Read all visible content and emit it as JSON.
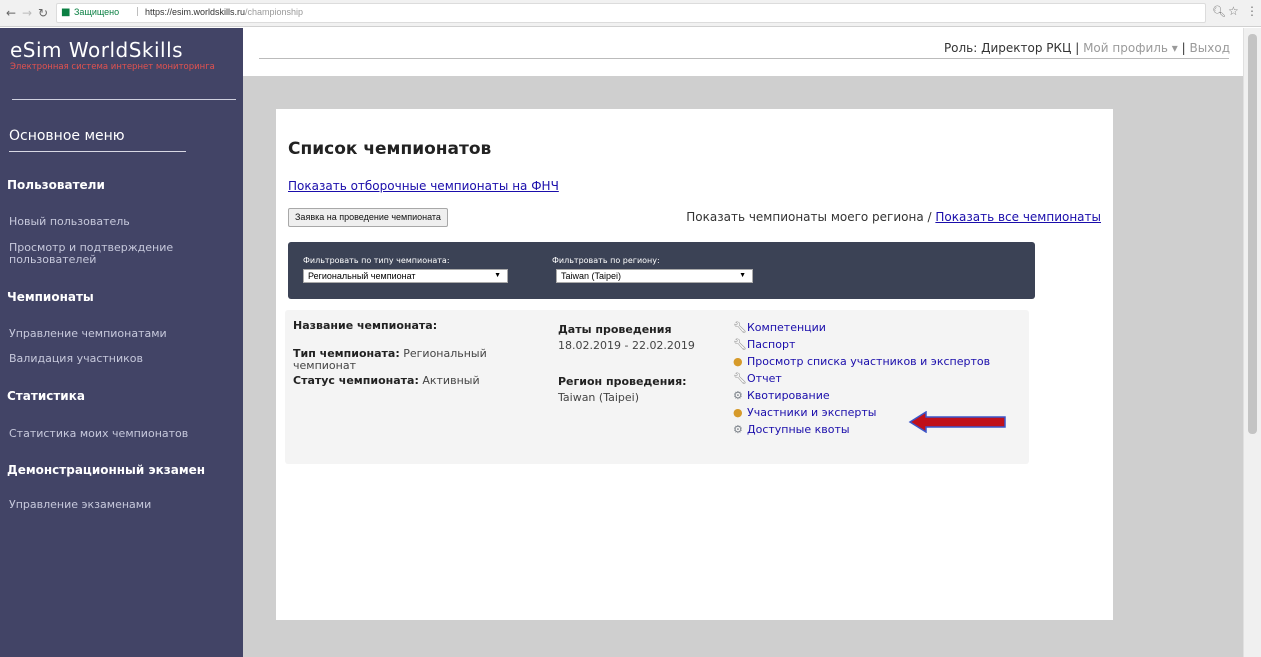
{
  "browser": {
    "secure_label": "Защищено",
    "url_host": "https://esim.worldskills.ru",
    "url_path": "/championship"
  },
  "sidebar": {
    "brand": "eSim WorldSkills",
    "brand_sub": "Электронная система интернет мониторинга",
    "menu_title": "Основное меню",
    "sections": {
      "users": "Пользователи",
      "championships": "Чемпионаты",
      "stats": "Статистика",
      "demo": "Демонстрационный экзамен"
    },
    "items": {
      "new_user": "Новый пользователь",
      "view_users": "Просмотр и подтверждение пользователей",
      "manage_champs": "Управление чемпионатами",
      "validate": "Валидация участников",
      "my_stats": "Статистика моих чемпионатов",
      "manage_exams": "Управление экзаменами"
    }
  },
  "header": {
    "role": "Роль: Директор РКЦ",
    "sep1": "|",
    "profile": "Мой профиль ▾",
    "sep2": "|",
    "logout": "Выход"
  },
  "main": {
    "title": "Список чемпионатов",
    "qualifier_link": "Показать отборочные чемпионаты на ФНЧ",
    "request_button": "Заявка на проведение чемпионата",
    "region_toggle": {
      "mine": "Показать чемпионаты моего региона",
      "sep": " / ",
      "all": "Показать все чемпионаты"
    },
    "filters": {
      "type_label": "Фильтровать по типу чемпионата:",
      "type_value": "Региональный чемпионат",
      "region_label": "Фильтровать по региону:",
      "region_value": "Taiwan (Taipei)"
    },
    "championship": {
      "name_label": "Название чемпионата:",
      "type_label": "Тип чемпионата:",
      "type_value": "Региональный чемпионат",
      "status_label": "Статус чемпионата:",
      "status_value": "Активный",
      "dates_label": "Даты проведения",
      "dates_value": "18.02.2019 - 22.02.2019",
      "region_label": "Регион проведения:",
      "region_value": "Taiwan (Taipei)",
      "actions": [
        {
          "label": "Компетенции",
          "icon": "wrench-icon"
        },
        {
          "label": "Паспорт",
          "icon": "wrench-icon"
        },
        {
          "label": "Просмотр списка участников и экспертов",
          "icon": "person-icon"
        },
        {
          "label": "Отчет",
          "icon": "wrench-icon"
        },
        {
          "label": "Квотирование",
          "icon": "gear-icon"
        },
        {
          "label": "Участники и эксперты",
          "icon": "person-icon"
        },
        {
          "label": "Доступные квоты",
          "icon": "gear-icon"
        }
      ]
    }
  },
  "colors": {
    "sidebar_bg": "#424466",
    "filter_bg": "#3b4255",
    "link": "#1a0dab",
    "brand_sub": "#e3524f",
    "arrow_fill": "#c0101a",
    "arrow_stroke": "#3a55c9"
  }
}
